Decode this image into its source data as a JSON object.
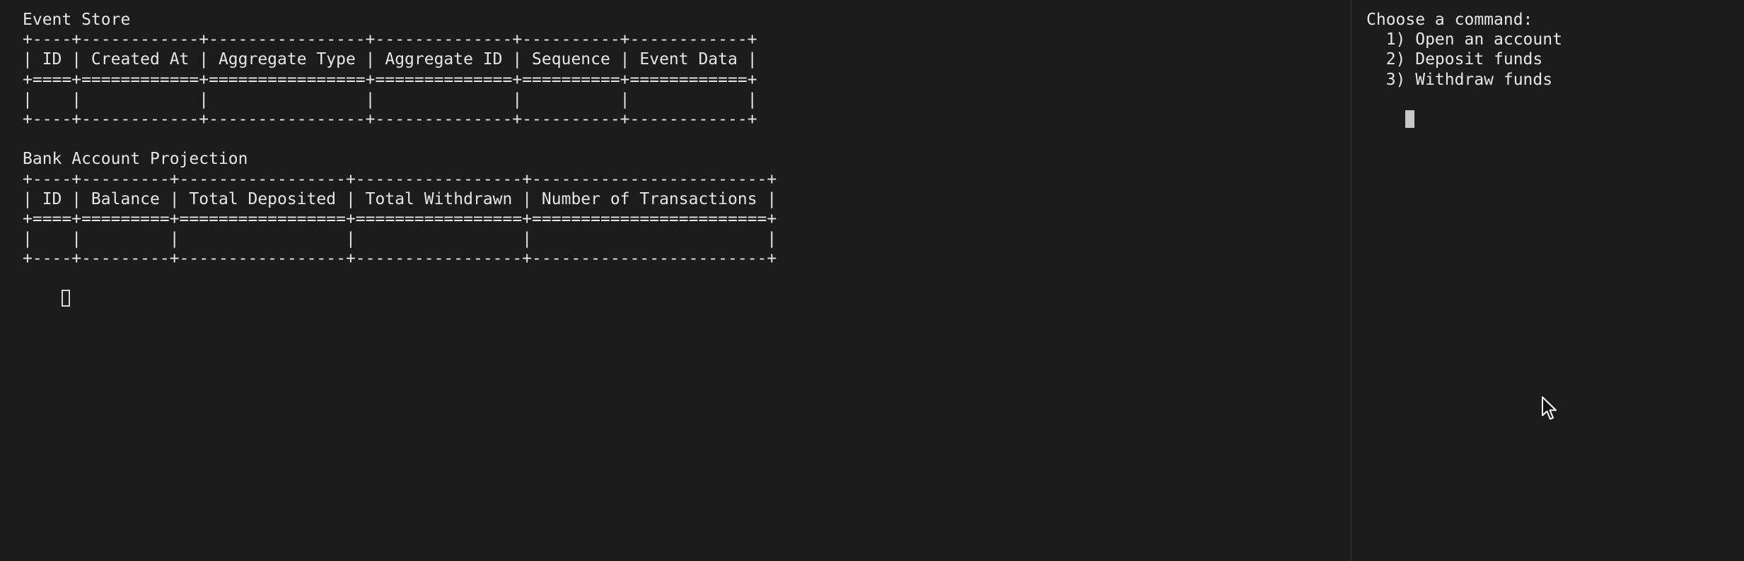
{
  "left_pane": {
    "event_store": {
      "title": "Event Store",
      "border_top": "+----+------------+----------------+--------------+----------+------------+",
      "header_row": "| ID | Created At | Aggregate Type | Aggregate ID | Sequence | Event Data |",
      "header_separator": "+====+============+================+==============+==========+============+",
      "empty_row": "|    |            |                |              |          |            |",
      "border_bottom": "+----+------------+----------------+--------------+----------+------------+"
    },
    "projection": {
      "title": "Bank Account Projection",
      "border_top": "+----+---------+-----------------+-----------------+------------------------+",
      "header_row": "| ID | Balance | Total Deposited | Total Withdrawn | Number of Transactions |",
      "header_separator": "+====+=========+=================+=================+========================+",
      "empty_row": "|    |         |                 |                 |                        |",
      "border_bottom": "+----+---------+-----------------+-----------------+------------------------+"
    }
  },
  "right_pane": {
    "prompt": "Choose a command:",
    "options": [
      "  1) Open an account",
      "  2) Deposit funds",
      "  3) Withdraw funds"
    ]
  },
  "colors": {
    "background": "#1c1c1c",
    "text": "#e6e6e6",
    "divider": "#2d2d2d"
  }
}
